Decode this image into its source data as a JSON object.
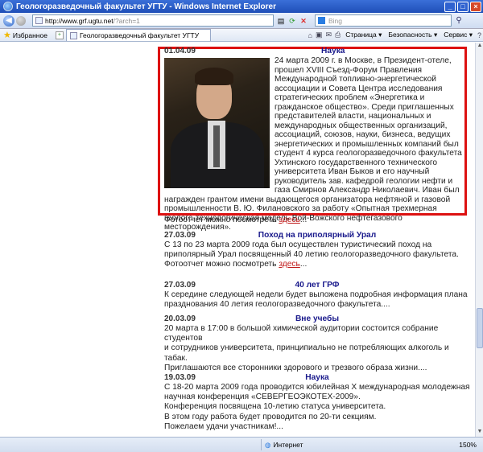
{
  "window": {
    "title": "Геологоразведочный факультет УГТУ - Windows Internet Explorer"
  },
  "address_bar": {
    "url_host": "http://www.grf.ugtu.net",
    "url_path": "/?arch=1",
    "search_placeholder": "Bing"
  },
  "command_bar": {
    "favorites_label": "Избранное",
    "tab_title": "Геологоразведочный факультет УГТУ",
    "page_menu": "Страница ▾",
    "safety_menu": "Безопасность ▾",
    "tools_menu": "Сервис ▾"
  },
  "news": [
    {
      "date": "01.04.09",
      "title": "Наука",
      "text": "24 марта 2009 г. в Москве, в Президент-отеле, прошел XVIII Съезд-Форум Правления Международной топливно-энергетической ассоциации и Совета Центра исследования стратегических проблем «Энергетика и гражданское общество». Среди приглашенных представителей власти, национальных и международных общественных организаций, ассоциаций, союзов, науки, бизнеса, ведущих энергетических и промышленных компаний был студент 4 курса геологоразведочного факультета Ухтинского государственного технического университета Иван Быков и его научный руководитель зав. кафедрой геологии нефти и газа Смирнов Александр Николаевич. Иван был награжден грантом имени выдающегося организатора нефтяной и газовой промышленности В. Ю. Филановского за работу «Опытная трехмерная геолого-технологическая модель Вой-Вожского нефтегазового месторождения».",
      "photo_link_prefix": "Фотоотчет можно посмотреть",
      "photo_link": "здесь",
      "photo_link_suffix": "..."
    },
    {
      "date": "27.03.09",
      "title": "Поход на приполярный Урал",
      "text": "С 13 по 23 марта 2009 года был осуществлен туристический поход на приполярный Урал посвященный 40 летию геологоразведочного факультета.",
      "photo_link_prefix": "Фотоотчет можно посмотреть",
      "photo_link": "здесь",
      "photo_link_suffix": "..."
    },
    {
      "date": "27.03.09",
      "title": "40 лет ГРФ",
      "text": "К середине следующей недели будет выложена подробная информация плана празднования 40 летия геологоразведочного факультета...."
    },
    {
      "date": "20.03.09",
      "title": "Вне учебы",
      "text1": "20 марта в 17:00 в большой химической аудитории состоится собрание студентов",
      "text2": "и сотрудников университета, принципиально не потребляющих алкоголь и табак.",
      "text3": "Приглашаются все сторонники здорового и трезвого образа жизни...."
    },
    {
      "date": "19.03.09",
      "title": "Наука",
      "text1": "С 18-20 марта 2009 года проводится юбилейная Х международная молодежная научная конференция «СЕВЕРГЕОЭКОТЕХ-2009».",
      "text2": "Конференция посвящена 10-летию статуса университета.",
      "text3": "В этом году работа будет проводится по 20-ти секциям.",
      "text4": "Пожелаем удачи участникам!..."
    }
  ],
  "status_bar": {
    "zone": "Интернет",
    "zoom": "150%"
  }
}
